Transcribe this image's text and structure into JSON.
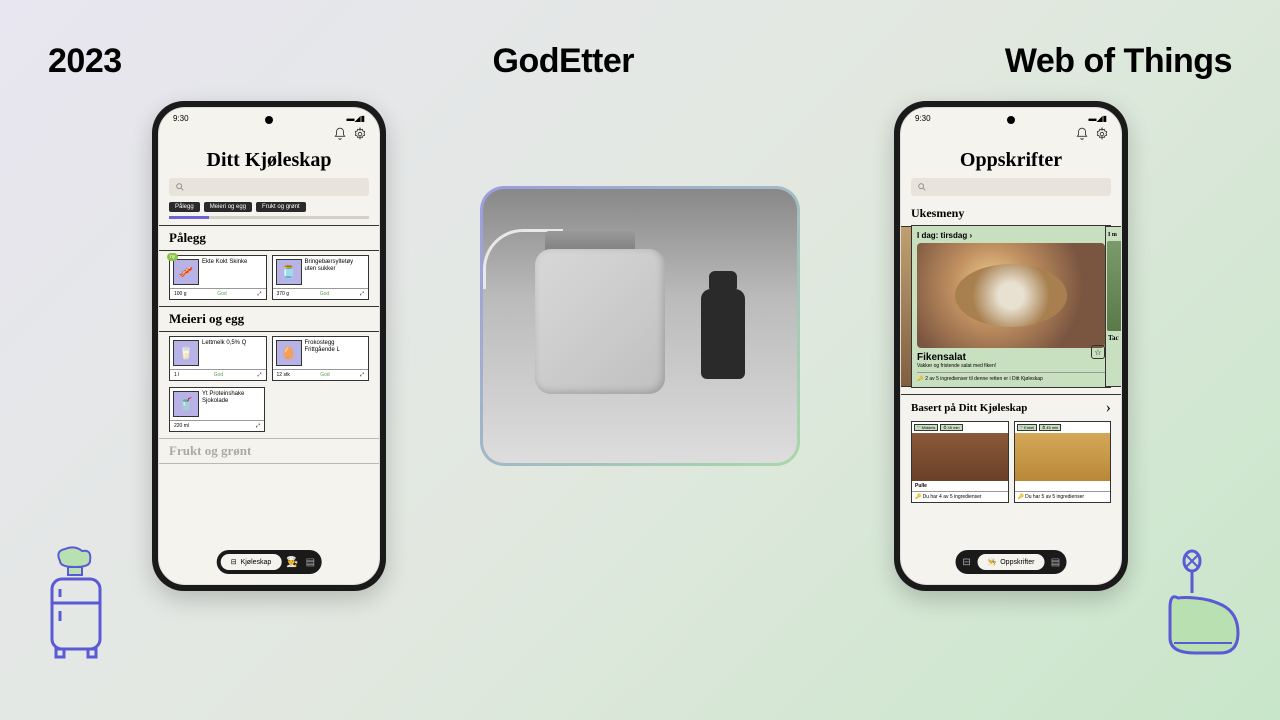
{
  "header": {
    "left": "2023",
    "center": "GodEtter",
    "right": "Web of Things"
  },
  "phone_left": {
    "time": "9:30",
    "title": "Ditt Kjøleskap",
    "chips": [
      "Pålegg",
      "Meieri og egg",
      "Frukt og grønt"
    ],
    "sec1": "Pålegg",
    "s1c1": {
      "name": "Ekte Kokt\nSkinke",
      "qty": "100 g",
      "state": "God",
      "new": "ny"
    },
    "s1c2": {
      "name": "Bringebærsyltetøy uten sukker",
      "qty": "370 g",
      "state": "God"
    },
    "sec2": "Meieri og egg",
    "s2c1": {
      "name": "Lettmelk 0,5% Q",
      "qty": "1 l",
      "state": "God"
    },
    "s2c2": {
      "name": "Frokostegg Frittgående L",
      "qty": "12 stk",
      "state": "God"
    },
    "s2c3": {
      "name": "Yt Proteinshake Sjokolade",
      "qty": "220 ml"
    },
    "sec3": "Frukt og grønt",
    "nav": {
      "active": "Kjøleskap"
    }
  },
  "phone_right": {
    "time": "9:30",
    "title": "Oppskrifter",
    "sub1": "Ukesmeny",
    "today": {
      "label": "I dag: tirsdag",
      "name": "Fikensalat",
      "desc": "Vakker og fristende salat med fiken!",
      "note": "2 av 5 ingredienser til denne retten er i Ditt Kjøleskap"
    },
    "peek": {
      "label": "I m",
      "name": "Tac"
    },
    "sub2": "Basert på Ditt Kjøleskap",
    "r1": {
      "diff": "Middels",
      "time": "45 min",
      "name": "Pulle",
      "have": "Du har 4 av 5 ingredienser"
    },
    "r2": {
      "diff": "Enkel",
      "time": "45 min",
      "have": "Du har 5 av 5 ingredienser"
    },
    "nav": {
      "active": "Oppskrifter"
    }
  }
}
